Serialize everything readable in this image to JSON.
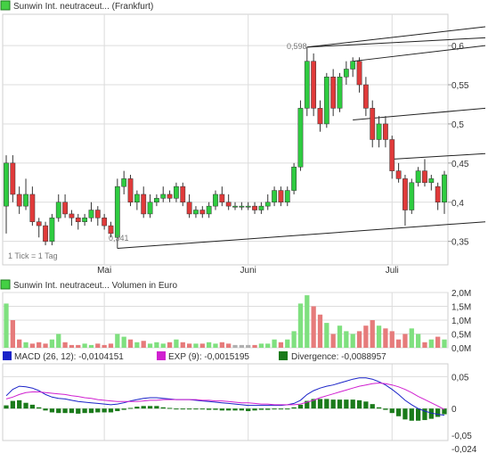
{
  "colors": {
    "up": "#2ecc40",
    "down": "#e03a3a",
    "neutral": "#b0b0b0",
    "volume_up": "#7fe07f",
    "volume_down": "#e67b7b",
    "macd_line": "#1a23c8",
    "exp_line": "#d020d0",
    "divergence": "#1a7a1a",
    "trend": "#222222",
    "grid": "#dcdcdc"
  },
  "chart_data": [
    {
      "type": "candlestick",
      "title": "Sunwin Int. neutraceut... (Frankfurt)",
      "legend_icon": "green-square",
      "annotations": {
        "high": "0,598",
        "low": "0,341",
        "footnote": "1 Tick = 1 Tag"
      },
      "x_tick_labels": [
        "Mai",
        "Juni",
        "Juli"
      ],
      "y_tick_labels": [
        "0,6",
        "0,55",
        "0,5",
        "0,45",
        "0,4",
        "0,35"
      ],
      "ylim": [
        0.32,
        0.64
      ],
      "grid": true,
      "days": 68,
      "month_start_index": {
        "Mai": 15,
        "Juni": 37,
        "Juli": 59
      },
      "candles": [
        [
          0.395,
          0.45,
          0.46,
          0.36
        ],
        [
          0.45,
          0.41,
          0.46,
          0.4
        ],
        [
          0.41,
          0.395,
          0.42,
          0.385
        ],
        [
          0.395,
          0.41,
          0.43,
          0.39
        ],
        [
          0.41,
          0.375,
          0.42,
          0.37
        ],
        [
          0.375,
          0.37,
          0.38,
          0.355
        ],
        [
          0.37,
          0.35,
          0.375,
          0.345
        ],
        [
          0.35,
          0.38,
          0.385,
          0.345
        ],
        [
          0.38,
          0.4,
          0.41,
          0.375
        ],
        [
          0.4,
          0.385,
          0.41,
          0.38
        ],
        [
          0.385,
          0.38,
          0.39,
          0.37
        ],
        [
          0.38,
          0.375,
          0.385,
          0.365
        ],
        [
          0.375,
          0.38,
          0.385,
          0.37
        ],
        [
          0.38,
          0.39,
          0.4,
          0.375
        ],
        [
          0.39,
          0.38,
          0.395,
          0.37
        ],
        [
          0.38,
          0.37,
          0.385,
          0.365
        ],
        [
          0.37,
          0.36,
          0.375,
          0.355
        ],
        [
          0.355,
          0.42,
          0.43,
          0.341
        ],
        [
          0.42,
          0.43,
          0.44,
          0.41
        ],
        [
          0.43,
          0.4,
          0.435,
          0.395
        ],
        [
          0.4,
          0.41,
          0.415,
          0.39
        ],
        [
          0.41,
          0.385,
          0.42,
          0.38
        ],
        [
          0.385,
          0.4,
          0.41,
          0.38
        ],
        [
          0.4,
          0.405,
          0.41,
          0.395
        ],
        [
          0.405,
          0.41,
          0.42,
          0.4
        ],
        [
          0.41,
          0.405,
          0.415,
          0.4
        ],
        [
          0.405,
          0.42,
          0.425,
          0.4
        ],
        [
          0.42,
          0.4,
          0.425,
          0.395
        ],
        [
          0.4,
          0.385,
          0.41,
          0.38
        ],
        [
          0.385,
          0.39,
          0.395,
          0.38
        ],
        [
          0.39,
          0.385,
          0.395,
          0.38
        ],
        [
          0.385,
          0.395,
          0.4,
          0.38
        ],
        [
          0.395,
          0.41,
          0.415,
          0.39
        ],
        [
          0.41,
          0.4,
          0.42,
          0.395
        ],
        [
          0.4,
          0.395,
          0.41,
          0.39
        ],
        [
          0.395,
          0.395,
          0.4,
          0.39
        ],
        [
          0.395,
          0.395,
          0.4,
          0.39
        ],
        [
          0.395,
          0.395,
          0.4,
          0.39
        ],
        [
          0.395,
          0.39,
          0.4,
          0.385
        ],
        [
          0.39,
          0.395,
          0.4,
          0.385
        ],
        [
          0.395,
          0.4,
          0.41,
          0.39
        ],
        [
          0.4,
          0.415,
          0.42,
          0.395
        ],
        [
          0.415,
          0.4,
          0.42,
          0.395
        ],
        [
          0.4,
          0.415,
          0.42,
          0.395
        ],
        [
          0.415,
          0.445,
          0.45,
          0.41
        ],
        [
          0.445,
          0.52,
          0.53,
          0.44
        ],
        [
          0.52,
          0.58,
          0.598,
          0.51
        ],
        [
          0.58,
          0.52,
          0.59,
          0.51
        ],
        [
          0.52,
          0.5,
          0.53,
          0.49
        ],
        [
          0.5,
          0.56,
          0.565,
          0.495
        ],
        [
          0.56,
          0.52,
          0.57,
          0.51
        ],
        [
          0.52,
          0.56,
          0.565,
          0.515
        ],
        [
          0.56,
          0.57,
          0.58,
          0.55
        ],
        [
          0.57,
          0.58,
          0.585,
          0.56
        ],
        [
          0.58,
          0.55,
          0.585,
          0.54
        ],
        [
          0.55,
          0.52,
          0.56,
          0.51
        ],
        [
          0.52,
          0.48,
          0.53,
          0.47
        ],
        [
          0.48,
          0.5,
          0.51,
          0.47
        ],
        [
          0.5,
          0.48,
          0.51,
          0.47
        ],
        [
          0.48,
          0.44,
          0.485,
          0.43
        ],
        [
          0.44,
          0.43,
          0.45,
          0.425
        ],
        [
          0.43,
          0.39,
          0.435,
          0.37
        ],
        [
          0.39,
          0.425,
          0.43,
          0.385
        ],
        [
          0.425,
          0.44,
          0.445,
          0.42
        ],
        [
          0.44,
          0.425,
          0.455,
          0.42
        ],
        [
          0.425,
          0.43,
          0.435,
          0.415
        ],
        [
          0.42,
          0.4,
          0.425,
          0.39
        ],
        [
          0.4,
          0.435,
          0.44,
          0.385
        ]
      ],
      "trend_lines": [
        {
          "from": [
            17,
            0.341
          ],
          "to": [
            67.5,
            0.375
          ]
        },
        {
          "from": [
            46,
            0.598
          ],
          "to": [
            67.5,
            0.624
          ]
        },
        {
          "from": [
            46,
            0.598
          ],
          "to": [
            67.5,
            0.61
          ]
        },
        {
          "from": [
            53,
            0.58
          ],
          "to": [
            67.5,
            0.6
          ]
        },
        {
          "from": [
            53,
            0.505
          ],
          "to": [
            67.5,
            0.52
          ]
        },
        {
          "from": [
            59,
            0.455
          ],
          "to": [
            67.5,
            0.462
          ]
        }
      ]
    },
    {
      "type": "bar",
      "title": "Sunwin Int. neutraceut... Volumen in Euro",
      "legend_icon": "green-square",
      "y_tick_labels": [
        "2,0M",
        "1,5M",
        "1,0M",
        "0,5M",
        "0,0M"
      ],
      "ylim": [
        0,
        2.0
      ],
      "unit": "M EUR",
      "values": [
        1.6,
        1.0,
        0.3,
        0.2,
        0.15,
        0.2,
        0.15,
        0.3,
        0.5,
        0.2,
        0.1,
        0.1,
        0.15,
        0.1,
        0.15,
        0.1,
        0.15,
        0.5,
        0.4,
        0.3,
        0.2,
        0.25,
        0.15,
        0.2,
        0.15,
        0.2,
        0.3,
        0.2,
        0.15,
        0.15,
        0.15,
        0.2,
        0.15,
        0.2,
        0.15,
        0.1,
        0.1,
        0.1,
        0.1,
        0.15,
        0.15,
        0.3,
        0.2,
        0.3,
        0.6,
        1.6,
        1.9,
        1.5,
        1.2,
        0.9,
        0.5,
        0.8,
        0.6,
        0.5,
        0.6,
        0.8,
        1.0,
        0.8,
        0.7,
        0.6,
        0.3,
        0.5,
        0.7,
        0.5,
        0.2,
        0.3,
        0.4,
        0.3
      ],
      "directions": [
        "u",
        "d",
        "d",
        "u",
        "d",
        "d",
        "d",
        "u",
        "u",
        "d",
        "d",
        "d",
        "u",
        "u",
        "d",
        "d",
        "d",
        "u",
        "u",
        "d",
        "u",
        "d",
        "u",
        "u",
        "u",
        "d",
        "u",
        "d",
        "d",
        "u",
        "d",
        "u",
        "u",
        "d",
        "d",
        "n",
        "n",
        "n",
        "d",
        "u",
        "u",
        "u",
        "d",
        "u",
        "u",
        "u",
        "u",
        "d",
        "d",
        "u",
        "d",
        "u",
        "u",
        "u",
        "d",
        "d",
        "d",
        "u",
        "d",
        "d",
        "d",
        "d",
        "u",
        "u",
        "d",
        "u",
        "d",
        "u"
      ]
    },
    {
      "type": "line",
      "title": "MACD",
      "legend": [
        {
          "name": "MACD (26, 12): -0,0104151",
          "color_key": "macd_line"
        },
        {
          "name": "EXP (9): -0,0015195",
          "color_key": "exp_line"
        },
        {
          "name": "Divergence: -0,0088957",
          "color_key": "divergence"
        }
      ],
      "y_tick_labels": [
        "0,05",
        "0",
        "-0,05",
        "-0,024"
      ],
      "ylim": [
        -0.05,
        0.07
      ],
      "series": [
        {
          "name": "MACD (26, 12): -0,0104151",
          "values": [
            0.02,
            0.03,
            0.035,
            0.034,
            0.032,
            0.028,
            0.022,
            0.018,
            0.016,
            0.015,
            0.013,
            0.011,
            0.01,
            0.009,
            0.008,
            0.007,
            0.006,
            0.007,
            0.009,
            0.012,
            0.014,
            0.016,
            0.017,
            0.017,
            0.016,
            0.015,
            0.014,
            0.014,
            0.014,
            0.013,
            0.012,
            0.011,
            0.01,
            0.009,
            0.008,
            0.007,
            0.006,
            0.005,
            0.005,
            0.005,
            0.005,
            0.005,
            0.005,
            0.006,
            0.008,
            0.013,
            0.022,
            0.028,
            0.032,
            0.035,
            0.037,
            0.04,
            0.043,
            0.046,
            0.048,
            0.048,
            0.046,
            0.042,
            0.037,
            0.03,
            0.022,
            0.013,
            0.006,
            0.0,
            -0.004,
            -0.007,
            -0.009,
            -0.0104
          ]
        },
        {
          "name": "EXP (9): -0,0015195",
          "values": [
            0.015,
            0.018,
            0.022,
            0.025,
            0.026,
            0.026,
            0.025,
            0.024,
            0.023,
            0.022,
            0.02,
            0.019,
            0.017,
            0.016,
            0.014,
            0.013,
            0.012,
            0.011,
            0.011,
            0.011,
            0.011,
            0.012,
            0.013,
            0.013,
            0.014,
            0.014,
            0.014,
            0.014,
            0.014,
            0.014,
            0.013,
            0.013,
            0.012,
            0.012,
            0.011,
            0.01,
            0.009,
            0.009,
            0.008,
            0.007,
            0.007,
            0.006,
            0.006,
            0.006,
            0.006,
            0.007,
            0.01,
            0.013,
            0.017,
            0.02,
            0.023,
            0.026,
            0.029,
            0.032,
            0.035,
            0.037,
            0.039,
            0.04,
            0.039,
            0.037,
            0.034,
            0.03,
            0.025,
            0.019,
            0.014,
            0.009,
            0.004,
            -0.0015
          ]
        },
        {
          "name": "Divergence: -0,0088957",
          "values": [
            0.005,
            0.012,
            0.013,
            0.009,
            0.006,
            0.002,
            -0.003,
            -0.006,
            -0.007,
            -0.007,
            -0.007,
            -0.008,
            -0.007,
            -0.007,
            -0.006,
            -0.006,
            -0.006,
            -0.004,
            -0.002,
            0.001,
            0.003,
            0.004,
            0.004,
            0.004,
            0.002,
            0.001,
            0.0,
            0.0,
            0.0,
            -0.001,
            -0.001,
            -0.002,
            -0.002,
            -0.003,
            -0.003,
            -0.003,
            -0.003,
            -0.004,
            -0.003,
            -0.002,
            -0.002,
            -0.001,
            -0.001,
            0.0,
            0.002,
            0.006,
            0.012,
            0.015,
            0.015,
            0.015,
            0.014,
            0.014,
            0.014,
            0.014,
            0.013,
            0.011,
            0.007,
            0.002,
            -0.002,
            -0.007,
            -0.012,
            -0.017,
            -0.019,
            -0.019,
            -0.018,
            -0.016,
            -0.013,
            -0.0089
          ]
        }
      ]
    }
  ]
}
